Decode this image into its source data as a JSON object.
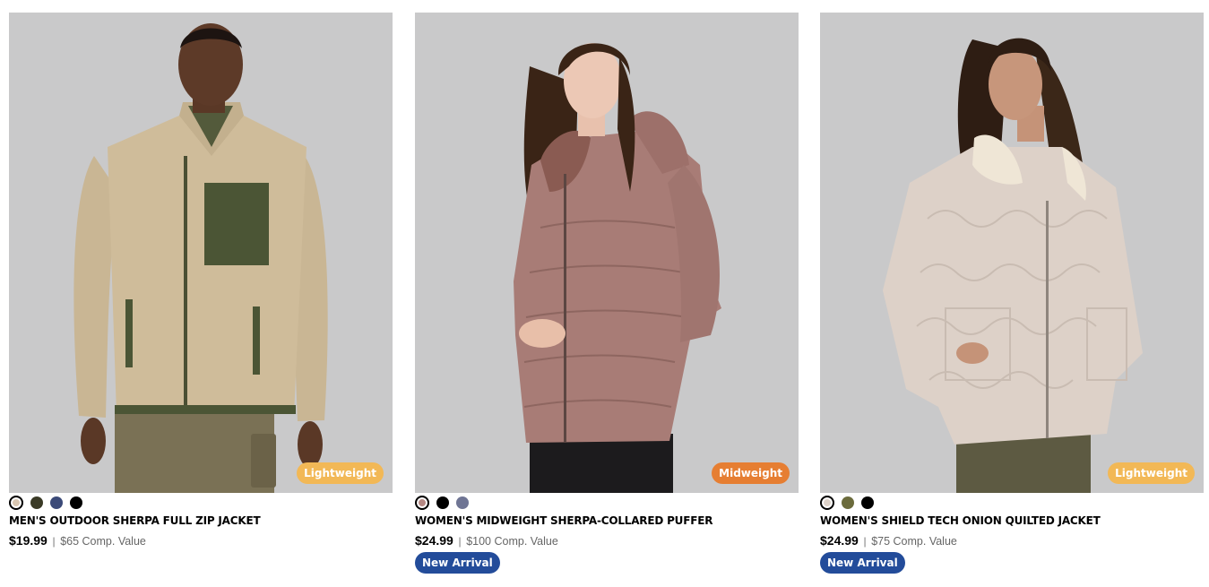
{
  "products": [
    {
      "title": "MEN'S OUTDOOR SHERPA FULL ZIP JACKET",
      "price": "$19.99",
      "separator": "|",
      "comp_value": "$65 Comp. Value",
      "weight_badge": "Lightweight",
      "weight_badge_color": "#f2b856",
      "new_arrival": "",
      "swatches": [
        "#d9c7b2",
        "#3a3a26",
        "#3b4a78",
        "#000000"
      ],
      "selected_swatch": 0
    },
    {
      "title": "WOMEN'S MIDWEIGHT SHERPA-COLLARED PUFFER",
      "price": "$24.99",
      "separator": "|",
      "comp_value": "$100 Comp. Value",
      "weight_badge": "Midweight",
      "weight_badge_color": "#e67e32",
      "new_arrival": "New Arrival",
      "swatches": [
        "#b58883",
        "#000000",
        "#6f7594"
      ],
      "selected_swatch": 0
    },
    {
      "title": "WOMEN'S SHIELD TECH ONION QUILTED JACKET",
      "price": "$24.99",
      "separator": "|",
      "comp_value": "$75 Comp. Value",
      "weight_badge": "Lightweight",
      "weight_badge_color": "#f2b856",
      "new_arrival": "New Arrival",
      "swatches": [
        "#ddd2c9",
        "#6b6b3c",
        "#000000"
      ],
      "selected_swatch": 0
    }
  ],
  "colors": {
    "image_bg": "#c9c9ca",
    "new_arrival_bg": "#234c9a"
  }
}
